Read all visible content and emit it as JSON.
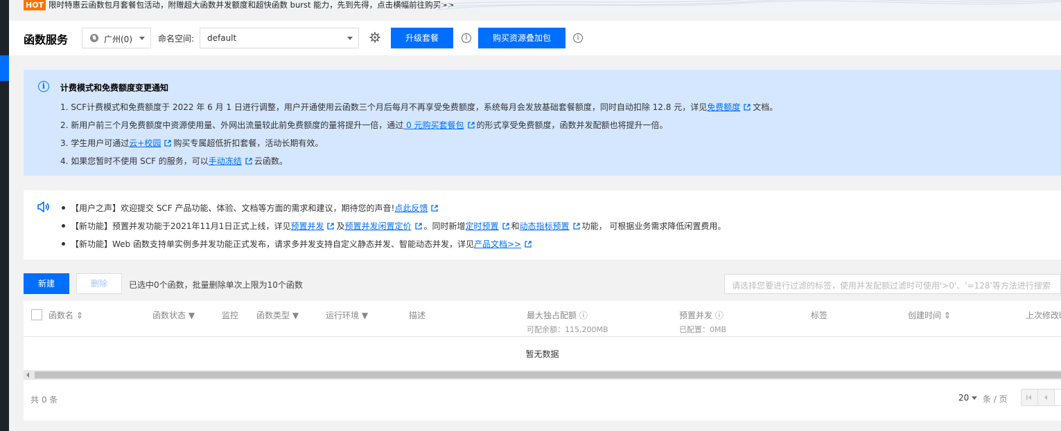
{
  "banner": {
    "hot_label": "HOT",
    "message": "限时特惠云函数包月套餐包活动，附赠超大函数并发额度和超快函数 burst 能力，先到先得，点击横幅前往购买>>"
  },
  "header": {
    "title": "函数服务",
    "region": "广州(0)",
    "namespace_label": "命名空间:",
    "namespace_value": "default",
    "upgrade_button": "升级套餐",
    "buy_button": "购买资源叠加包"
  },
  "notice": {
    "title": "计费模式和免费额度变更通知",
    "line1_pre": "1. SCF计费模式和免费额度于 2022 年 6 月 1 日进行调整，用户开通使用云函数三个月后每月不再享受免费额度，系统每月会发放基础套餐额度，同时自动扣除 12.8 元，详见",
    "line1_link": "免费额度",
    "line1_post": "文档。",
    "line2_pre": "2. 新用户前三个月免费额度中资源使用量、外网出流量较此前免费额度的量将提升一倍，通过",
    "line2_link": " 0 元购买套餐包",
    "line2_post": "的形式享受免费额度，函数并发配额也将提升一倍。",
    "line3_pre": "3. 学生用户可通过",
    "line3_link": "云+校园",
    "line3_post": "购买专属超低折扣套餐，活动长期有效。",
    "line4_pre": "4. 如果您暂时不使用 SCF 的服务，可以",
    "line4_link": "手动冻结",
    "line4_post": "云函数。"
  },
  "news": {
    "item1_pre": "【用户之声】欢迎提交 SCF 产品功能、体验、文档等方面的需求和建议，期待您的声音!",
    "item1_link": "点此反馈",
    "item2_pre": "【新功能】预置并发功能于2021年11月1日正式上线，详见",
    "item2_link1": "预置并发",
    "item2_mid1": "及",
    "item2_link2": "预置并发闲置定价",
    "item2_mid2": "。同时新增",
    "item2_link3": "定时预置",
    "item2_mid3": "和",
    "item2_link4": "动态指标预置",
    "item2_post": "功能， 可根据业务需求降低闲置费用。",
    "item3_pre": "【新功能】Web 函数支持单实例多并发功能正式发布，请求多并发支持自定义静态并发、智能动态并发，详见",
    "item3_link": "产品文档>>"
  },
  "toolbar": {
    "new_button": "新建",
    "delete_button": "删除",
    "selection_info": "已选中0个函数，批量删除单次上限为10个函数",
    "search_placeholder": "请选择您要进行过滤的标签，使用并发配额过滤时可使用'>0'、'=128'等方法进行搜索"
  },
  "table": {
    "columns": {
      "name": "函数名",
      "status": "函数状态",
      "monitor": "监控",
      "type": "函数类型",
      "runtime": "运行环境",
      "desc": "描述",
      "max_quota": "最大独占配额",
      "max_quota_sub": "可配余额：115,200MB",
      "provisioned": "预置并发",
      "provisioned_sub": "已配置：0MB",
      "tags": "标签",
      "created": "创建时间",
      "modified": "上次修改时"
    },
    "empty_text": "暂无数据",
    "total": "共 0 条",
    "page_size": "20",
    "page_unit": "条 / 页"
  },
  "colors": {
    "primary": "#006eff",
    "notice_bg": "#d5e7fe",
    "hot": "#ff7200"
  }
}
